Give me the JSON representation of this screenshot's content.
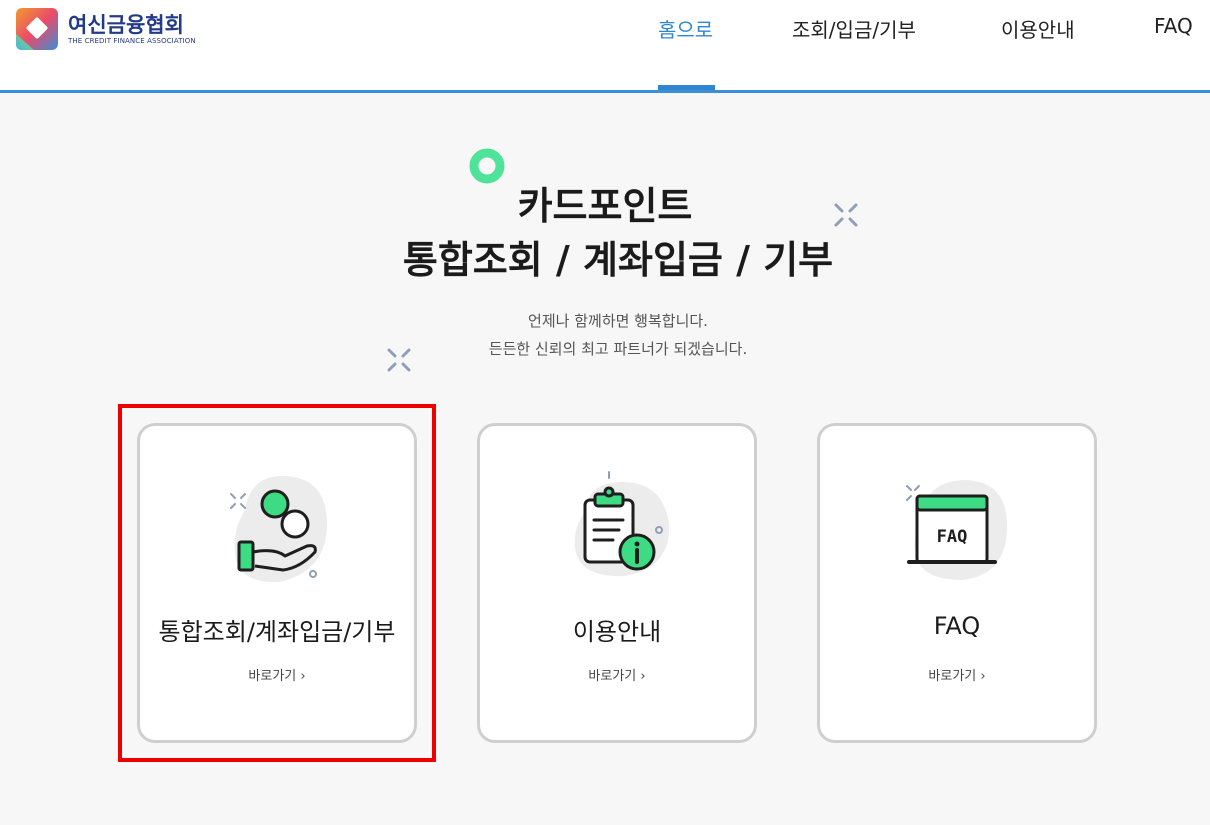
{
  "header": {
    "logo_ko": "여신금융협회",
    "logo_en": "THE CREDIT FINANCE ASSOCIATION"
  },
  "nav": {
    "items": [
      {
        "label": "홈으로",
        "active": true
      },
      {
        "label": "조회/입금/기부",
        "active": false
      },
      {
        "label": "이용안내",
        "active": false
      },
      {
        "label": "FAQ",
        "active": false
      }
    ]
  },
  "hero": {
    "title_line1": "카드포인트",
    "title_line2": "통합조회 / 계좌입금 / 기부",
    "subtitle_line1": "언제나 함께하면 행복합니다.",
    "subtitle_line2": "든든한 신뢰의 최고 파트너가 되겠습니다."
  },
  "cards": [
    {
      "title": "통합조회/계좌입금/기부",
      "link": "바로가기 ›",
      "icon": "hand-coin-icon"
    },
    {
      "title": "이용안내",
      "link": "바로가기 ›",
      "icon": "clipboard-info-icon"
    },
    {
      "title": "FAQ",
      "link": "바로가기 ›",
      "icon": "faq-screen-icon",
      "icon_text": "FAQ"
    }
  ],
  "colors": {
    "accent": "#2f86cf",
    "brand": "#233a86",
    "icon_green": "#3ddc84",
    "highlight": "#ee0000"
  }
}
